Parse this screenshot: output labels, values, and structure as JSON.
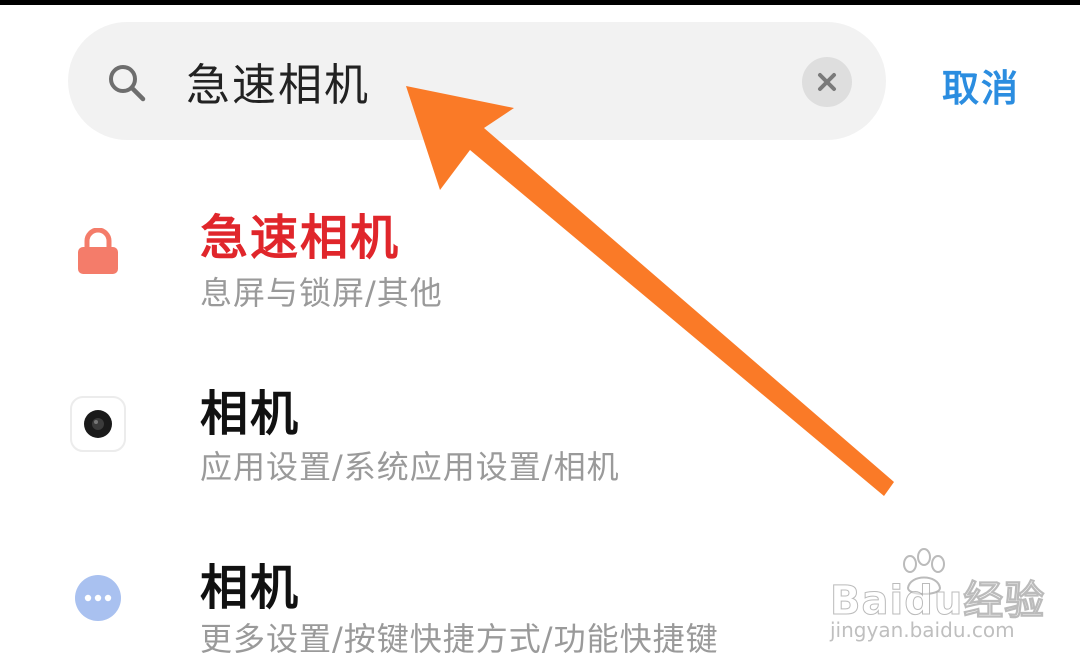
{
  "search": {
    "value": "急速相机",
    "cancel_label": "取消"
  },
  "results": [
    {
      "title": "急速相机",
      "path": "息屏与锁屏/其他",
      "icon": "lock-icon",
      "title_color": "#e0262b"
    },
    {
      "title": "相机",
      "path": "应用设置/系统应用设置/相机",
      "icon": "camera-icon",
      "title_color": "#111111"
    },
    {
      "title": "相机",
      "path": "更多设置/按键快捷方式/功能快捷键",
      "icon": "more-icon",
      "title_color": "#111111"
    }
  ],
  "annotation": {
    "arrow_color": "#fa7a27"
  },
  "watermark": {
    "brand": "Baidu经验",
    "url": "jingyan.baidu.com"
  },
  "colors": {
    "accent": "#2b8de0",
    "lock_icon": "#f47c6a",
    "more_icon": "#a9c1f0"
  }
}
